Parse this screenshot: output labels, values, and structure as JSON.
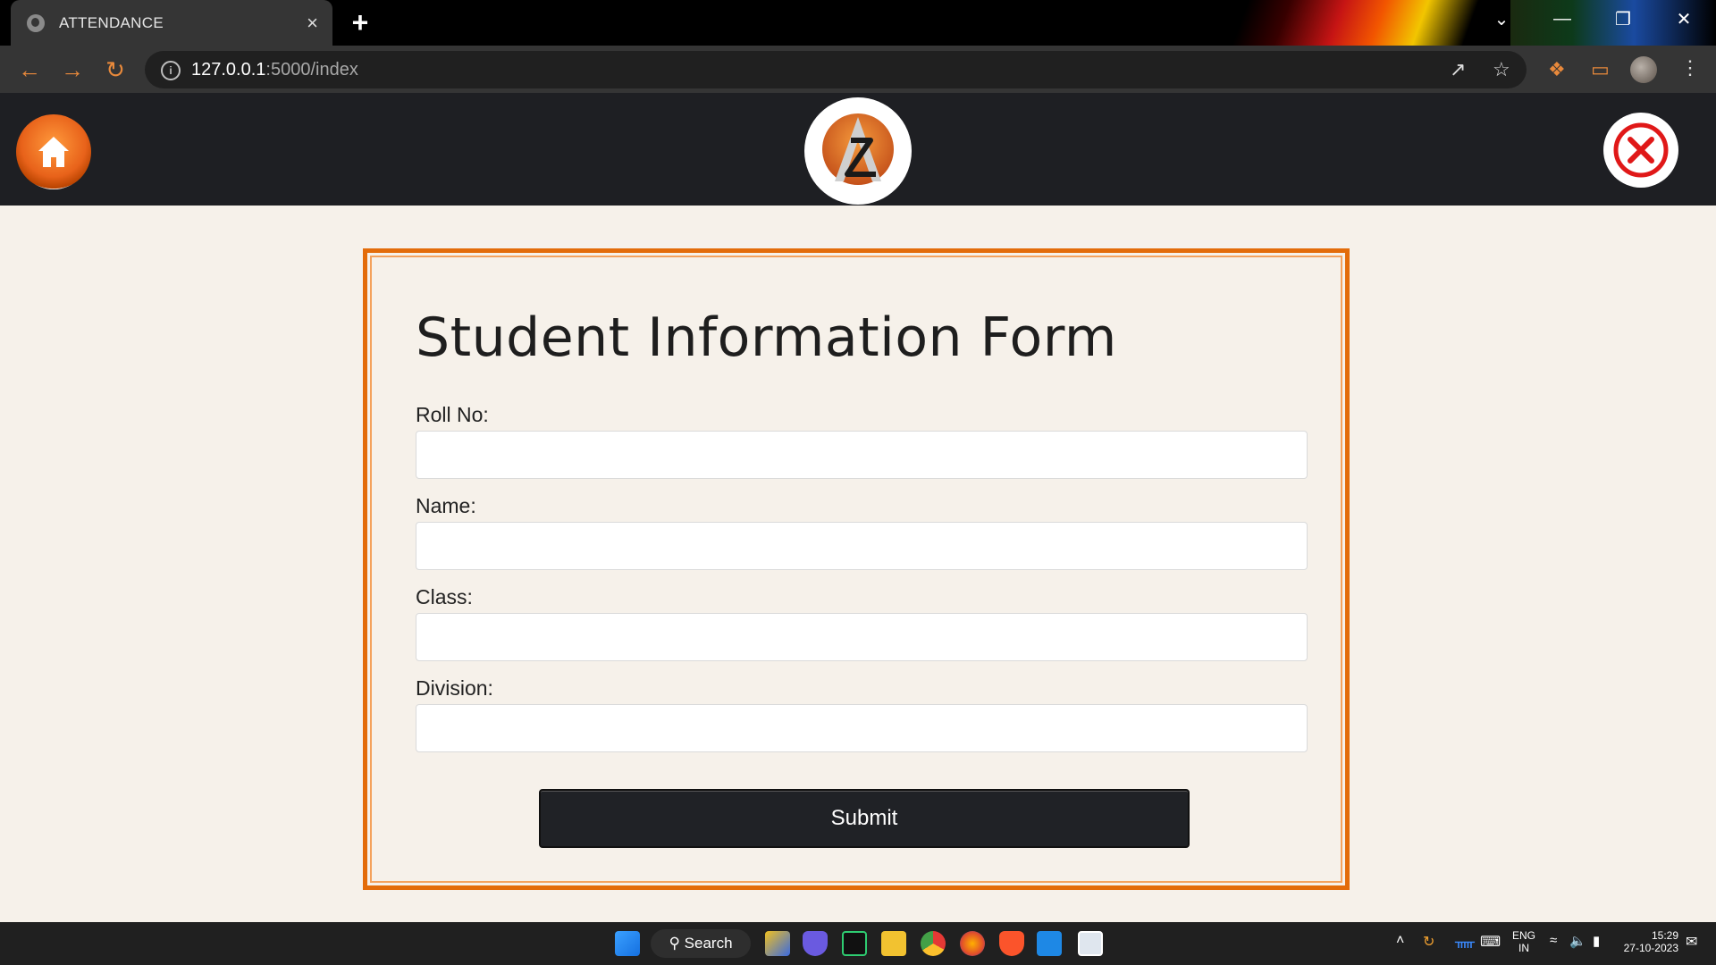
{
  "browser": {
    "tab_title": "ATTENDANCE",
    "tab_close": "×",
    "new_tab": "+",
    "url_host": "127.0.0.1",
    "url_path": ":5000/index",
    "win_minimize": "—",
    "win_restore": "❐",
    "win_close": "✕",
    "win_dropdown": "⌄"
  },
  "header": {
    "home_icon": "home-icon",
    "logo_icon": "app-logo",
    "close_icon": "close-icon"
  },
  "form": {
    "title": "Student Information Form",
    "fields": [
      {
        "label": "Roll No:",
        "value": ""
      },
      {
        "label": "Name:",
        "value": ""
      },
      {
        "label": "Class:",
        "value": ""
      },
      {
        "label": "Division:",
        "value": ""
      }
    ],
    "submit_label": "Submit"
  },
  "taskbar": {
    "search_label": "Search",
    "lang_top": "ENG",
    "lang_bottom": "IN",
    "time": "15:29",
    "date": "27-10-2023"
  },
  "colors": {
    "accent": "#e36c0a",
    "header_bg": "#1e1f23",
    "page_bg": "#f6f1ea",
    "button_bg": "#202226"
  }
}
